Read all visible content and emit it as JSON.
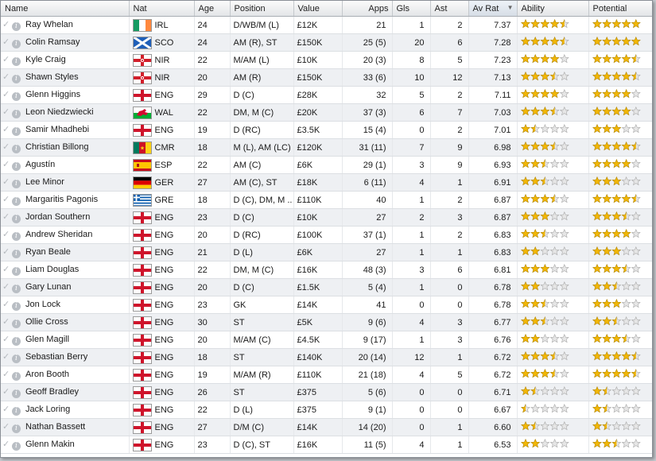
{
  "headers": {
    "name": "Name",
    "nat": "Nat",
    "age": "Age",
    "position": "Position",
    "value": "Value",
    "apps": "Apps",
    "gls": "Gls",
    "ast": "Ast",
    "avrat": "Av Rat",
    "ability": "Ability",
    "potential": "Potential"
  },
  "colors": {
    "star_fill": "#f2b705",
    "star_empty": "#e6e6e6",
    "star_stroke": "#b88a00"
  },
  "players": [
    {
      "name": "Ray Whelan",
      "nat": "IRL",
      "age": "24",
      "position": "D/WB/M (L)",
      "value": "£12K",
      "apps": "21",
      "gls": "1",
      "ast": "2",
      "avrat": "7.37",
      "ability": 4.5,
      "potential": 5
    },
    {
      "name": "Colin Ramsay",
      "nat": "SCO",
      "age": "24",
      "position": "AM (R), ST",
      "value": "£150K",
      "apps": "25 (5)",
      "gls": "20",
      "ast": "6",
      "avrat": "7.28",
      "ability": 4.5,
      "potential": 5
    },
    {
      "name": "Kyle Craig",
      "nat": "NIR",
      "age": "22",
      "position": "M/AM (L)",
      "value": "£10K",
      "apps": "20 (3)",
      "gls": "8",
      "ast": "5",
      "avrat": "7.23",
      "ability": 4,
      "potential": 4.5
    },
    {
      "name": "Shawn Styles",
      "nat": "NIR",
      "age": "20",
      "position": "AM (R)",
      "value": "£150K",
      "apps": "33 (6)",
      "gls": "10",
      "ast": "12",
      "avrat": "7.13",
      "ability": 3.5,
      "potential": 4.5
    },
    {
      "name": "Glenn Higgins",
      "nat": "ENG",
      "age": "29",
      "position": "D (C)",
      "value": "£28K",
      "apps": "32",
      "gls": "5",
      "ast": "2",
      "avrat": "7.11",
      "ability": 4,
      "potential": 4
    },
    {
      "name": "Leon Niedzwiecki",
      "nat": "WAL",
      "age": "22",
      "position": "DM, M (C)",
      "value": "£20K",
      "apps": "37 (3)",
      "gls": "6",
      "ast": "7",
      "avrat": "7.03",
      "ability": 3.5,
      "potential": 4
    },
    {
      "name": "Samir Mhadhebi",
      "nat": "ENG",
      "age": "19",
      "position": "D (RC)",
      "value": "£3.5K",
      "apps": "15 (4)",
      "gls": "0",
      "ast": "2",
      "avrat": "7.01",
      "ability": 1.5,
      "potential": 3
    },
    {
      "name": "Christian Billong",
      "nat": "CMR",
      "age": "18",
      "position": "M (L), AM (LC)",
      "value": "£120K",
      "apps": "31 (11)",
      "gls": "7",
      "ast": "9",
      "avrat": "6.98",
      "ability": 3.5,
      "potential": 4.5
    },
    {
      "name": "Agustín",
      "nat": "ESP",
      "age": "22",
      "position": "AM (C)",
      "value": "£6K",
      "apps": "29 (1)",
      "gls": "3",
      "ast": "9",
      "avrat": "6.93",
      "ability": 2.5,
      "potential": 4
    },
    {
      "name": "Lee Minor",
      "nat": "GER",
      "age": "27",
      "position": "AM (C), ST",
      "value": "£18K",
      "apps": "6 (11)",
      "gls": "4",
      "ast": "1",
      "avrat": "6.91",
      "ability": 2.5,
      "potential": 3
    },
    {
      "name": "Margaritis Pagonis",
      "nat": "GRE",
      "age": "18",
      "position": "D (C), DM, M ..",
      "value": "£110K",
      "apps": "40",
      "gls": "1",
      "ast": "2",
      "avrat": "6.87",
      "ability": 3.5,
      "potential": 4.5
    },
    {
      "name": "Jordan Southern",
      "nat": "ENG",
      "age": "23",
      "position": "D (C)",
      "value": "£10K",
      "apps": "27",
      "gls": "2",
      "ast": "3",
      "avrat": "6.87",
      "ability": 3,
      "potential": 3.5
    },
    {
      "name": "Andrew Sheridan",
      "nat": "ENG",
      "age": "20",
      "position": "D (RC)",
      "value": "£100K",
      "apps": "37 (1)",
      "gls": "1",
      "ast": "2",
      "avrat": "6.83",
      "ability": 2.5,
      "potential": 4
    },
    {
      "name": "Ryan Beale",
      "nat": "ENG",
      "age": "21",
      "position": "D (L)",
      "value": "£6K",
      "apps": "27",
      "gls": "1",
      "ast": "1",
      "avrat": "6.83",
      "ability": 2,
      "potential": 3
    },
    {
      "name": "Liam Douglas",
      "nat": "ENG",
      "age": "22",
      "position": "DM, M (C)",
      "value": "£16K",
      "apps": "48 (3)",
      "gls": "3",
      "ast": "6",
      "avrat": "6.81",
      "ability": 3,
      "potential": 3.5
    },
    {
      "name": "Gary Lunan",
      "nat": "ENG",
      "age": "20",
      "position": "D (C)",
      "value": "£1.5K",
      "apps": "5 (4)",
      "gls": "1",
      "ast": "0",
      "avrat": "6.78",
      "ability": 2,
      "potential": 2.5
    },
    {
      "name": "Jon Lock",
      "nat": "ENG",
      "age": "23",
      "position": "GK",
      "value": "£14K",
      "apps": "41",
      "gls": "0",
      "ast": "0",
      "avrat": "6.78",
      "ability": 2.5,
      "potential": 3
    },
    {
      "name": "Ollie Cross",
      "nat": "ENG",
      "age": "30",
      "position": "ST",
      "value": "£5K",
      "apps": "9 (6)",
      "gls": "4",
      "ast": "3",
      "avrat": "6.77",
      "ability": 2.5,
      "potential": 2.5
    },
    {
      "name": "Glen Magill",
      "nat": "ENG",
      "age": "20",
      "position": "M/AM (C)",
      "value": "£4.5K",
      "apps": "9 (17)",
      "gls": "1",
      "ast": "3",
      "avrat": "6.76",
      "ability": 2,
      "potential": 3.5
    },
    {
      "name": "Sebastian Berry",
      "nat": "ENG",
      "age": "18",
      "position": "ST",
      "value": "£140K",
      "apps": "20 (14)",
      "gls": "12",
      "ast": "1",
      "avrat": "6.72",
      "ability": 3.5,
      "potential": 4.5
    },
    {
      "name": "Aron Booth",
      "nat": "ENG",
      "age": "19",
      "position": "M/AM (R)",
      "value": "£110K",
      "apps": "21 (18)",
      "gls": "4",
      "ast": "5",
      "avrat": "6.72",
      "ability": 3.5,
      "potential": 4.5
    },
    {
      "name": "Geoff Bradley",
      "nat": "ENG",
      "age": "26",
      "position": "ST",
      "value": "£375",
      "apps": "5 (6)",
      "gls": "0",
      "ast": "0",
      "avrat": "6.71",
      "ability": 1.5,
      "potential": 1.5
    },
    {
      "name": "Jack Loring",
      "nat": "ENG",
      "age": "22",
      "position": "D (L)",
      "value": "£375",
      "apps": "9 (1)",
      "gls": "0",
      "ast": "0",
      "avrat": "6.67",
      "ability": 0.5,
      "potential": 1.5
    },
    {
      "name": "Nathan Bassett",
      "nat": "ENG",
      "age": "27",
      "position": "D/M (C)",
      "value": "£14K",
      "apps": "14 (20)",
      "gls": "0",
      "ast": "1",
      "avrat": "6.60",
      "ability": 1.5,
      "potential": 1.5
    },
    {
      "name": "Glenn Makin",
      "nat": "ENG",
      "age": "23",
      "position": "D (C), ST",
      "value": "£16K",
      "apps": "11 (5)",
      "gls": "4",
      "ast": "1",
      "avrat": "6.53",
      "ability": 2,
      "potential": 2.5
    }
  ]
}
